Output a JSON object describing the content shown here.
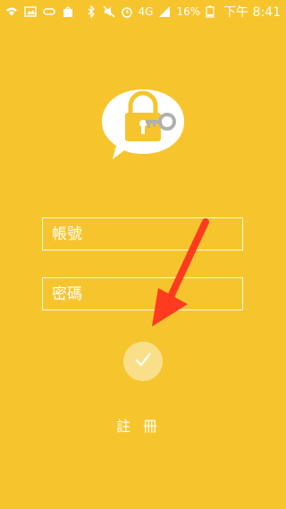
{
  "status_bar": {
    "battery": "16%",
    "network": "4G",
    "time": "下午 8:41"
  },
  "login": {
    "account_placeholder": "帳號",
    "password_placeholder": "密碼",
    "register_label": "註冊"
  },
  "icons": {
    "logo": "lock-key-icon",
    "submit": "check-icon"
  },
  "colors": {
    "background": "#f6c52d",
    "logo_lock": "#f6c52d",
    "key": "#b0b0b0",
    "arrow": "#ff3b1f"
  }
}
